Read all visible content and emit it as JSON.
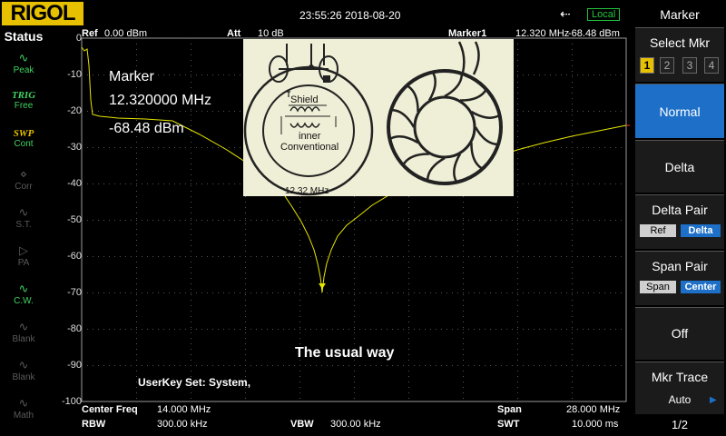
{
  "app": {
    "brand": "RIGOL",
    "datetime": "23:55:26 2018-08-20",
    "usb_icon": "usb-icon",
    "local_label": "Local"
  },
  "status": {
    "title": "Status",
    "items": [
      {
        "name": "peak",
        "icon": "peak-icon",
        "line1": "Peak",
        "state": "on"
      },
      {
        "name": "trig",
        "line1": "TRIG",
        "line2": "Free",
        "state": "on"
      },
      {
        "name": "swp",
        "line1": "SWP",
        "line2": "Cont",
        "state": "on"
      },
      {
        "name": "corr",
        "line1": "Corr",
        "state": "off"
      },
      {
        "name": "st",
        "line1": "S.T.",
        "state": "off"
      },
      {
        "name": "pa",
        "line1": "PA",
        "state": "off"
      },
      {
        "name": "cw",
        "line1": "C.W.",
        "state": "on"
      },
      {
        "name": "blank1",
        "line1": "Blank",
        "state": "off"
      },
      {
        "name": "blank2",
        "line1": "Blank",
        "state": "off"
      },
      {
        "name": "math",
        "line1": "Math",
        "state": "off"
      }
    ]
  },
  "header": {
    "ref_label": "Ref",
    "ref_value": "0.00 dBm",
    "att_label": "Att",
    "att_value": "10 dB",
    "marker_label": "Marker1",
    "marker_freq": "12.320 MHz",
    "marker_amp": "-68.48 dBm"
  },
  "y_ticks": [
    "0",
    "-10",
    "-20",
    "-30",
    "-40",
    "-50",
    "-60",
    "-70",
    "-80",
    "-90",
    "-100"
  ],
  "marker_readout": {
    "title": "Marker",
    "freq": "12.320000 MHz",
    "amp": "-68.48 dBm"
  },
  "overlay": {
    "labels": [
      "Shield",
      "inner",
      "Conventional"
    ],
    "freq_caption": "12.32 MHz",
    "caption": "The usual way"
  },
  "userkey": "UserKey Set:   System,",
  "bottom": {
    "center_label": "Center Freq",
    "center_value": "14.000 MHz",
    "span_label": "Span",
    "span_value": "28.000 MHz",
    "rbw_label": "RBW",
    "rbw_value": "300.00 kHz",
    "vbw_label": "VBW",
    "vbw_value": "300.00 kHz",
    "swt_label": "SWT",
    "swt_value": "10.000 ms"
  },
  "menu": {
    "title": "Marker",
    "select_label": "Select Mkr",
    "select_options": [
      "1",
      "2",
      "3",
      "4"
    ],
    "normal_label": "Normal",
    "delta_label": "Delta",
    "delta_pair_label": "Delta Pair",
    "delta_pair_options": [
      "Ref",
      "Delta"
    ],
    "span_pair_label": "Span Pair",
    "span_pair_options": [
      "Span",
      "Center"
    ],
    "off_label": "Off",
    "mkr_trace_label": "Mkr Trace",
    "mkr_trace_value": "Auto",
    "page": "1/2"
  },
  "colors": {
    "trace": "#e6e600",
    "accent": "#1d6fc8",
    "brand": "#e7c000",
    "status_on": "#3fd35f"
  }
}
